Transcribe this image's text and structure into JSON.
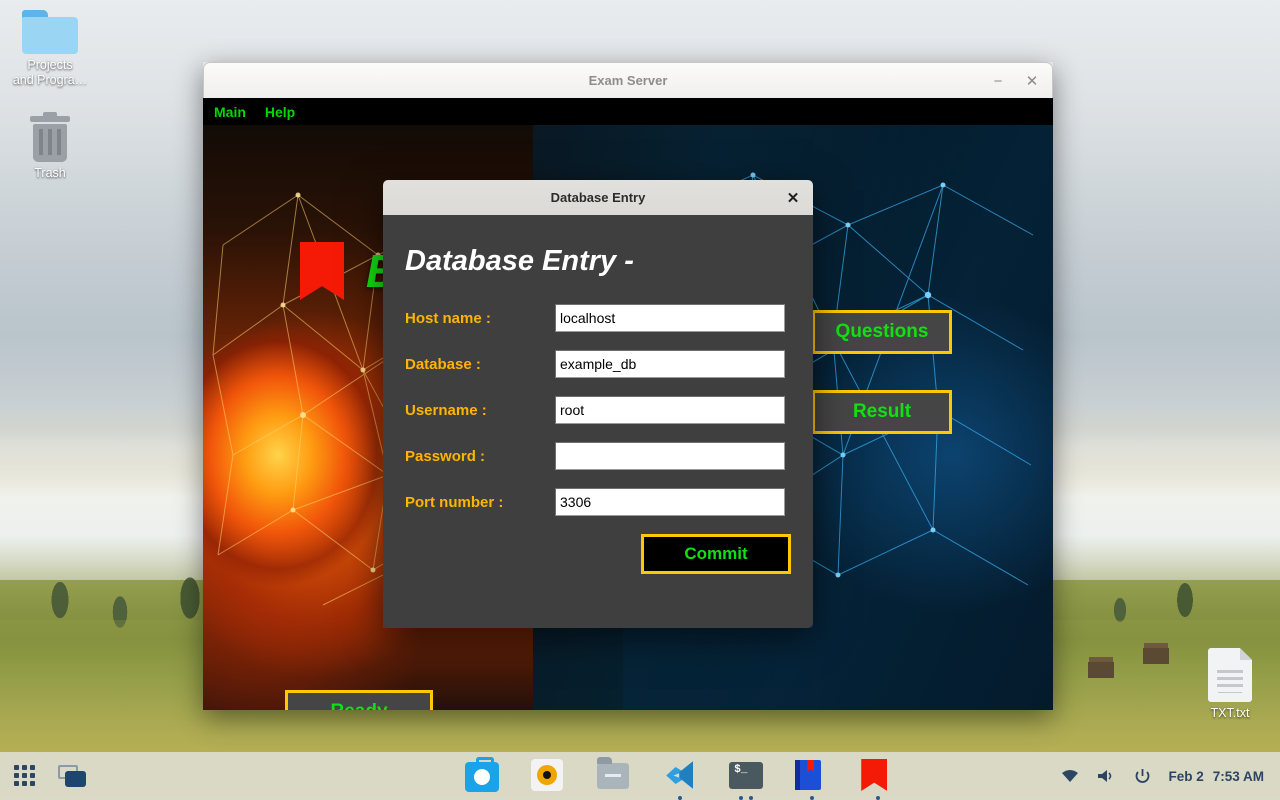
{
  "desktop": {
    "icons": [
      {
        "name": "projects-folder",
        "label": "Projects\nand Progra…",
        "label_line1": "Projects",
        "label_line2": "and Progra…"
      },
      {
        "name": "trash",
        "label": "Trash"
      },
      {
        "name": "txt-file",
        "label": "TXT.txt"
      }
    ]
  },
  "app_window": {
    "title": "Exam Server",
    "minimize_label": "−",
    "close_label": "✕",
    "menu": [
      {
        "label": "Main"
      },
      {
        "label": "Help"
      }
    ],
    "brand_text": "Exam Server",
    "buttons": [
      {
        "id": "questions",
        "label": "Questions"
      },
      {
        "id": "result",
        "label": "Result"
      },
      {
        "id": "ready",
        "label": "Ready"
      }
    ],
    "colors": {
      "menu_text": "#00d800",
      "button_border": "#ffc800",
      "button_text": "#12e012",
      "brand": "#14e014",
      "bookmark": "#f51a05"
    }
  },
  "dialog": {
    "titlebar_title": "Database Entry",
    "close_label": "✕",
    "heading": "Database Entry -",
    "fields": [
      {
        "id": "hostname",
        "label": "Host name :",
        "value": "localhost",
        "placeholder": ""
      },
      {
        "id": "database",
        "label": "Database :",
        "value": "example_db",
        "placeholder": ""
      },
      {
        "id": "username",
        "label": "Username :",
        "value": "root",
        "placeholder": ""
      },
      {
        "id": "password",
        "label": "Password :",
        "value": "",
        "placeholder": ""
      },
      {
        "id": "port",
        "label": "Port number :",
        "value": "3306",
        "placeholder": ""
      }
    ],
    "commit_label": "Commit",
    "colors": {
      "background": "#3f3f3f",
      "label_text": "#ffb400",
      "commit_border": "#ffc800",
      "commit_text": "#12e012"
    }
  },
  "taskbar": {
    "left": [
      {
        "name": "app-grid",
        "label": ""
      },
      {
        "name": "window-switcher",
        "label": ""
      }
    ],
    "apps": [
      {
        "name": "software-store-icon",
        "label": "",
        "running": false
      },
      {
        "name": "audio-player-icon",
        "label": "",
        "running": false
      },
      {
        "name": "file-manager-icon",
        "label": "",
        "running": false
      },
      {
        "name": "vscode-icon",
        "label": "",
        "running": true
      },
      {
        "name": "terminal-icon",
        "label": "",
        "running": true,
        "instances": 2
      },
      {
        "name": "book-app-icon",
        "label": "",
        "running": true
      },
      {
        "name": "exam-server-icon",
        "label": "",
        "running": true
      }
    ],
    "tray": [
      {
        "name": "wifi-icon"
      },
      {
        "name": "volume-icon"
      },
      {
        "name": "power-icon"
      }
    ],
    "date": "Feb 2",
    "time": "7:53 AM"
  }
}
